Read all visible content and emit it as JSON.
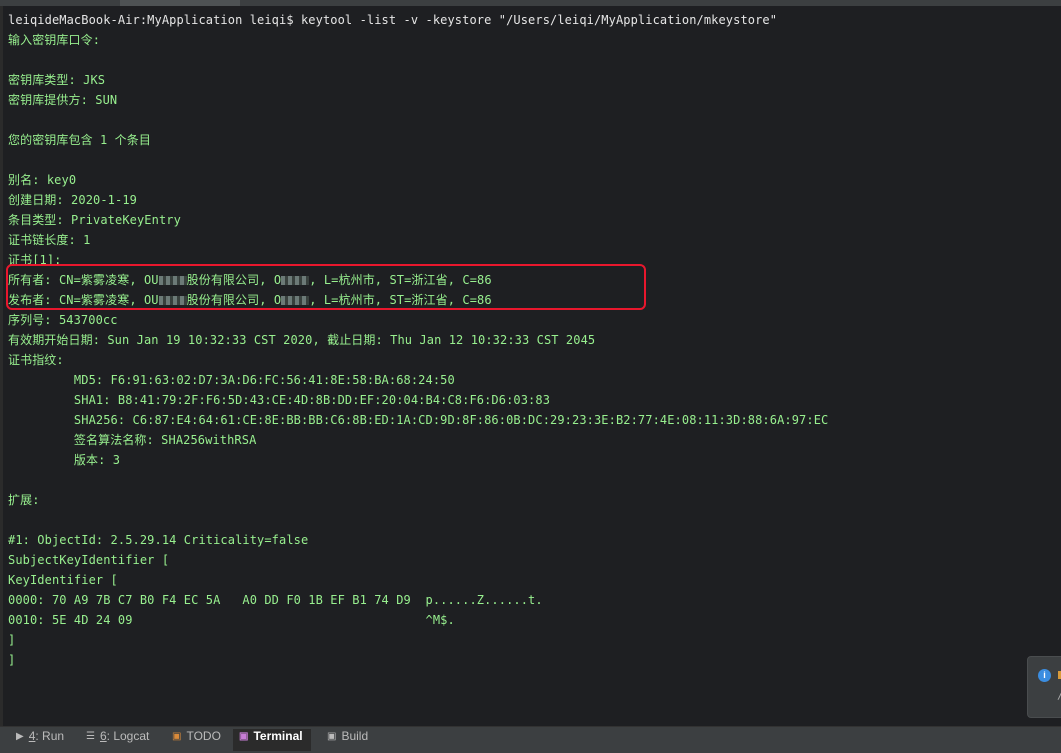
{
  "terminal": {
    "lines": [
      {
        "type": "prompt",
        "text": "leiqideMacBook-Air:MyApplication leiqi$ keytool -list -v -keystore \"/Users/leiqi/MyApplication/mkeystore\""
      },
      {
        "text": "输入密钥库口令:"
      },
      {
        "text": ""
      },
      {
        "text": "密钥库类型: JKS"
      },
      {
        "text": "密钥库提供方: SUN"
      },
      {
        "text": ""
      },
      {
        "text": "您的密钥库包含 1 个条目"
      },
      {
        "text": ""
      },
      {
        "text": "别名: key0"
      },
      {
        "text": "创建日期: 2020-1-19"
      },
      {
        "text": "条目类型: PrivateKeyEntry"
      },
      {
        "text": "证书链长度: 1"
      },
      {
        "text": "证书[1]:"
      },
      {
        "segments": [
          "所有者: CN=紫雾凌寒, OU",
          "股份有限公司, O",
          ", L=杭州市, ST=浙江省, C=86"
        ]
      },
      {
        "segments": [
          "发布者: CN=紫雾凌寒, OU",
          "股份有限公司, O",
          ", L=杭州市, ST=浙江省, C=86"
        ]
      },
      {
        "text": "序列号: 543700cc"
      },
      {
        "text": "有效期开始日期: Sun Jan 19 10:32:33 CST 2020, 截止日期: Thu Jan 12 10:32:33 CST 2045"
      },
      {
        "text": "证书指纹:"
      },
      {
        "text": "         MD5: F6:91:63:02:D7:3A:D6:FC:56:41:8E:58:BA:68:24:50"
      },
      {
        "text": "         SHA1: B8:41:79:2F:F6:5D:43:CE:4D:8B:DD:EF:20:04:B4:C8:F6:D6:03:83"
      },
      {
        "text": "         SHA256: C6:87:E4:64:61:CE:8E:BB:BB:C6:8B:ED:1A:CD:9D:8F:86:0B:DC:29:23:3E:B2:77:4E:08:11:3D:88:6A:97:EC"
      },
      {
        "text": "         签名算法名称: SHA256withRSA"
      },
      {
        "text": "         版本: 3"
      },
      {
        "text": ""
      },
      {
        "text": "扩展:"
      },
      {
        "text": ""
      },
      {
        "text": "#1: ObjectId: 2.5.29.14 Criticality=false"
      },
      {
        "text": "SubjectKeyIdentifier ["
      },
      {
        "text": "KeyIdentifier ["
      },
      {
        "text": "0000: 70 A9 7B C7 B0 F4 EC 5A   A0 DD F0 1B EF B1 74 D9  p......Z......t."
      },
      {
        "text": "0010: 5E 4D 24 09                                        ^M$."
      },
      {
        "text": "]"
      },
      {
        "text": "]"
      }
    ]
  },
  "toolbar": {
    "run": {
      "key": "4",
      "label": ": Run"
    },
    "logcat": {
      "key": "6",
      "label": ": Logcat"
    },
    "todo": {
      "label": "TODO"
    },
    "terminal": {
      "label": "Terminal"
    },
    "build": {
      "label": "Build"
    }
  },
  "icons": {
    "run": "play-icon",
    "logcat": "logcat-icon",
    "todo": "todo-icon",
    "terminal": "terminal-icon",
    "build": "build-icon",
    "notification": "info-icon"
  },
  "colors": {
    "terminal_background": "#1e1f22",
    "output_text": "#98f08f",
    "prompt_text": "#e6e6e6",
    "highlight_border": "#e8172d"
  }
}
